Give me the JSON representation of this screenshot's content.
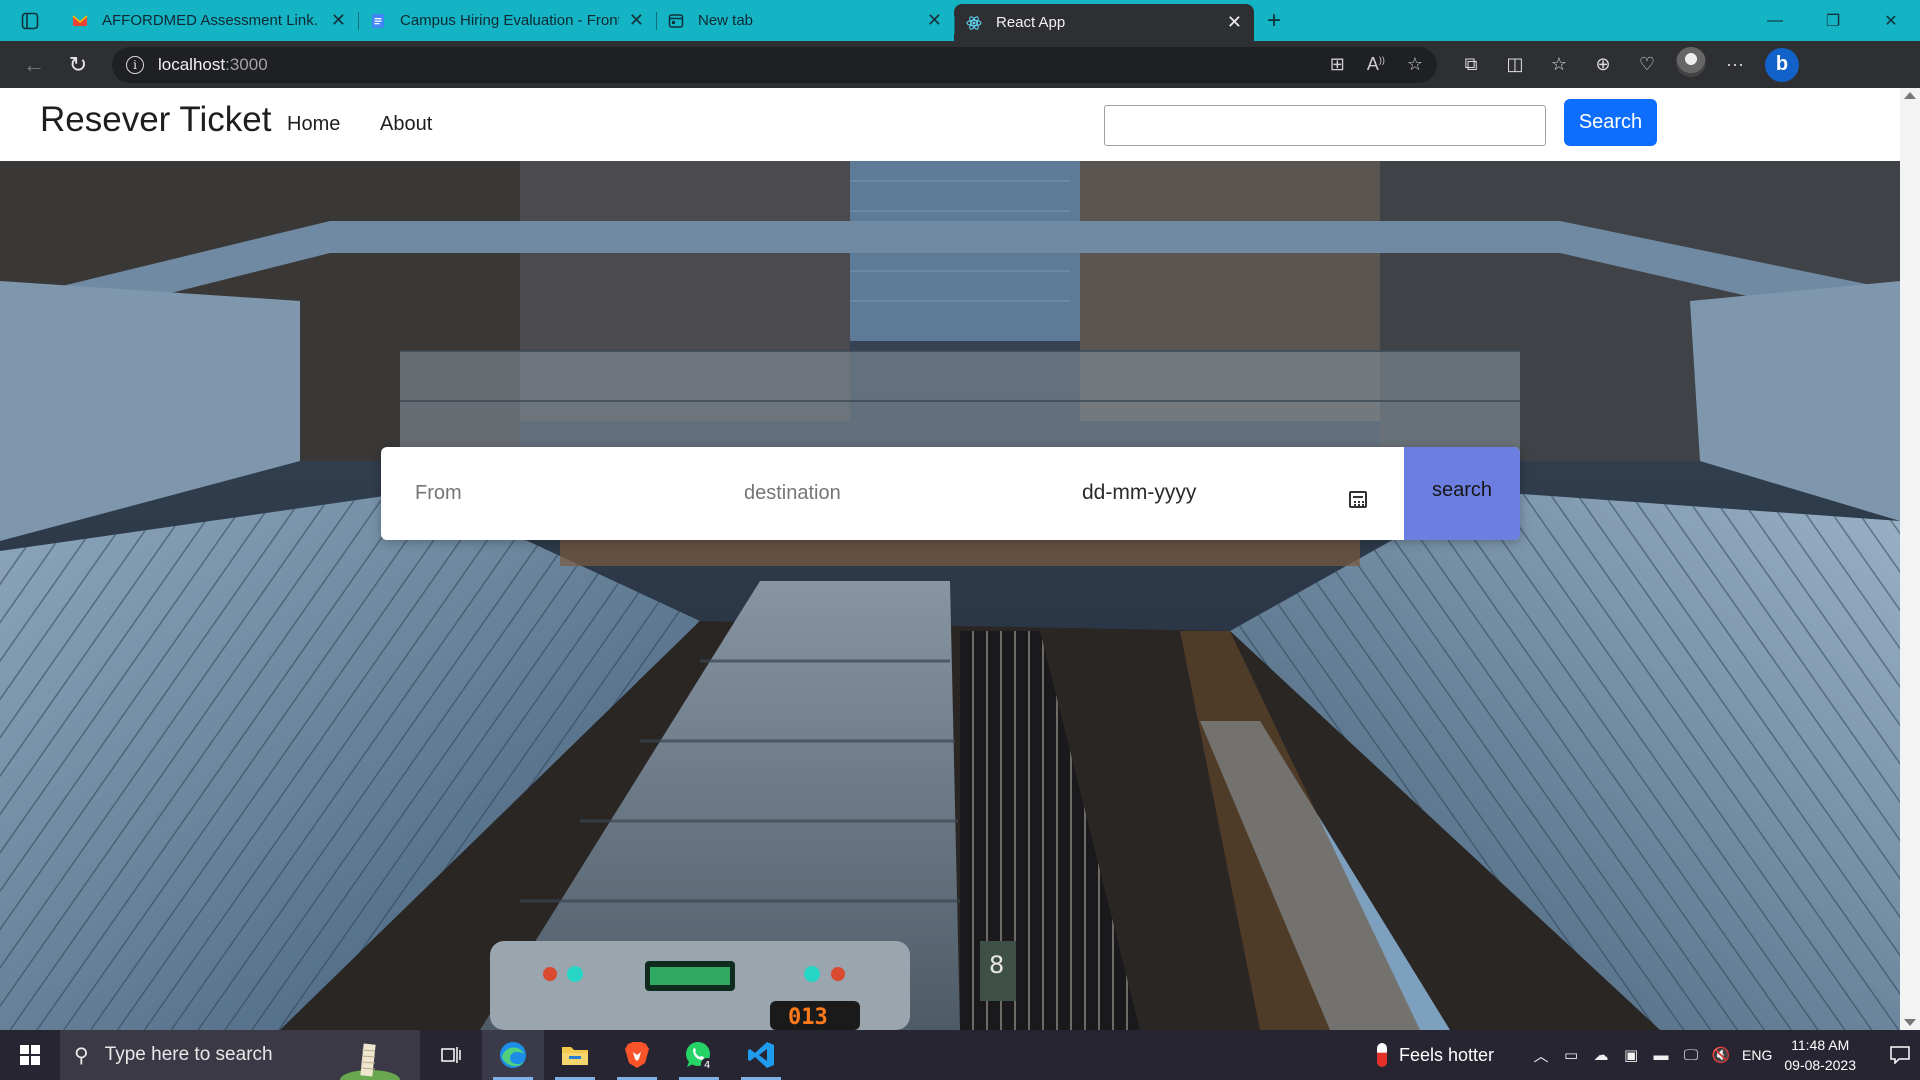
{
  "browser": {
    "tabs": [
      {
        "title": "AFFORDMED Assessment Link. -",
        "favicon": "gmail-icon",
        "active": false
      },
      {
        "title": "Campus Hiring Evaluation - Front",
        "favicon": "google-docs-icon",
        "active": false
      },
      {
        "title": "New tab",
        "favicon": "new-tab-icon",
        "active": false
      },
      {
        "title": "React App",
        "favicon": "react-icon",
        "active": true
      }
    ],
    "address": {
      "host": "localhost",
      "port": ":3000"
    }
  },
  "page": {
    "brand": "Resever Ticket",
    "nav_links": [
      "Home",
      "About"
    ],
    "search_button": "Search",
    "search_value": "",
    "booking": {
      "from_placeholder": "From",
      "destination_placeholder": "destination",
      "date_placeholder": "dd-mm-yyyy",
      "search_button": "search"
    },
    "hero_image": "elevated train station with train on tracks"
  },
  "taskbar": {
    "search_placeholder": "Type here to search",
    "apps": [
      "task-view-icon",
      "edge-icon",
      "file-explorer-icon",
      "brave-icon",
      "whatsapp-icon",
      "vscode-icon"
    ],
    "whatsapp_badge": "4",
    "weather": "Feels hotter",
    "language": "ENG",
    "time": "11:48 AM",
    "date": "09-08-2023"
  },
  "colors": {
    "tab_strip": "#14b4c4",
    "primary_button": "#0d6efd",
    "booking_button": "#6c7fe0",
    "taskbar": "#262531"
  }
}
